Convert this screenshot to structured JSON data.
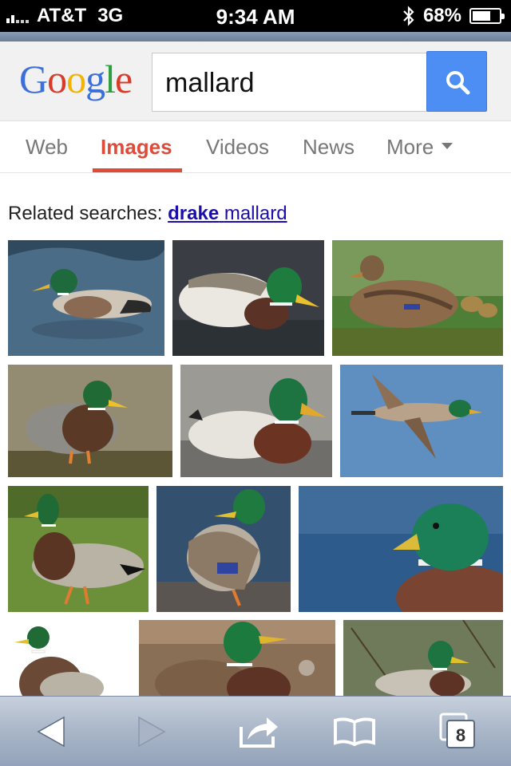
{
  "status_bar": {
    "carrier": "AT&T",
    "network": "3G",
    "time": "9:34 AM",
    "battery_percent": "68%",
    "battery_level": 0.68,
    "signal_bars": 2
  },
  "logo": {
    "text": "Google"
  },
  "search": {
    "query": "mallard"
  },
  "tabs": [
    {
      "label": "Web",
      "active": false
    },
    {
      "label": "Images",
      "active": true
    },
    {
      "label": "Videos",
      "active": false
    },
    {
      "label": "News",
      "active": false
    },
    {
      "label": "More",
      "active": false
    }
  ],
  "related": {
    "prefix": "Related searches:",
    "bold": "drake",
    "rest": "mallard"
  },
  "images": [
    {
      "alt": "mallard drake swimming"
    },
    {
      "alt": "mallard drake on water"
    },
    {
      "alt": "female mallard with ducklings"
    },
    {
      "alt": "mallard drake standing on shore"
    },
    {
      "alt": "mallard drake in water"
    },
    {
      "alt": "mallard in flight"
    },
    {
      "alt": "mallard standing on grass"
    },
    {
      "alt": "mallard standing on rock"
    },
    {
      "alt": "mallard head close-up"
    },
    {
      "alt": "mallard on white background"
    },
    {
      "alt": "mallard splashing"
    },
    {
      "alt": "mallard in reeds"
    }
  ],
  "toolbar": {
    "tab_count": "8"
  },
  "colors": {
    "accent": "#dd4b39",
    "link": "#1a0dab",
    "search_button": "#4d8ef5"
  }
}
